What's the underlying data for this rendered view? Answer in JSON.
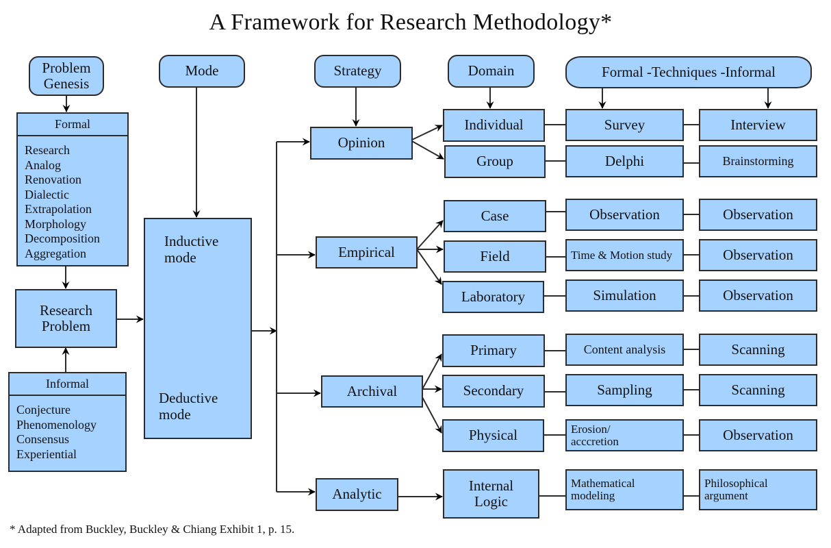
{
  "title": "A Framework for Research Methodology*",
  "footnote": "* Adapted from Buckley, Buckley & Chiang Exhibit 1, p. 15.",
  "headers": {
    "problem_genesis": "Problem Genesis",
    "mode": "Mode",
    "strategy": "Strategy",
    "domain": "Domain",
    "techniques": "Formal -Techniques -Informal"
  },
  "problem_genesis": {
    "formal": {
      "label": "Formal",
      "items": [
        "Research",
        "Analog",
        "Renovation",
        "Dialectic",
        "Extrapolation",
        "Morphology",
        "Decomposition",
        "Aggregation"
      ]
    },
    "research_problem": "Research Problem",
    "informal": {
      "label": "Informal",
      "items": [
        "Conjecture",
        "Phenomenology",
        "Consensus",
        "Experiential"
      ]
    }
  },
  "mode": {
    "inductive": "Inductive mode",
    "deductive": "Deductive mode"
  },
  "strategies": [
    {
      "label": "Opinion",
      "domains": [
        {
          "label": "Individual",
          "formal": "Survey",
          "informal": "Interview"
        },
        {
          "label": "Group",
          "formal": "Delphi",
          "informal": "Brainstorming"
        }
      ]
    },
    {
      "label": "Empirical",
      "domains": [
        {
          "label": "Case",
          "formal": "Observation",
          "informal": "Observation"
        },
        {
          "label": "Field",
          "formal": "Time & Motion study",
          "informal": "Observation"
        },
        {
          "label": "Laboratory",
          "formal": "Simulation",
          "informal": "Observation"
        }
      ]
    },
    {
      "label": "Archival",
      "domains": [
        {
          "label": "Primary",
          "formal": "Content analysis",
          "informal": "Scanning"
        },
        {
          "label": "Secondary",
          "formal": "Sampling",
          "informal": "Scanning"
        },
        {
          "label": "Physical",
          "formal": "Erosion/ acccretion",
          "informal": "Observation"
        }
      ]
    },
    {
      "label": "Analytic",
      "domains": [
        {
          "label": "Internal Logic",
          "formal": "Mathematical modeling",
          "informal": "Philosophical argument"
        }
      ]
    }
  ],
  "colors": {
    "box_fill": "#a6d2ff",
    "stroke": "#2b2b2b",
    "background": "#ffffff"
  }
}
